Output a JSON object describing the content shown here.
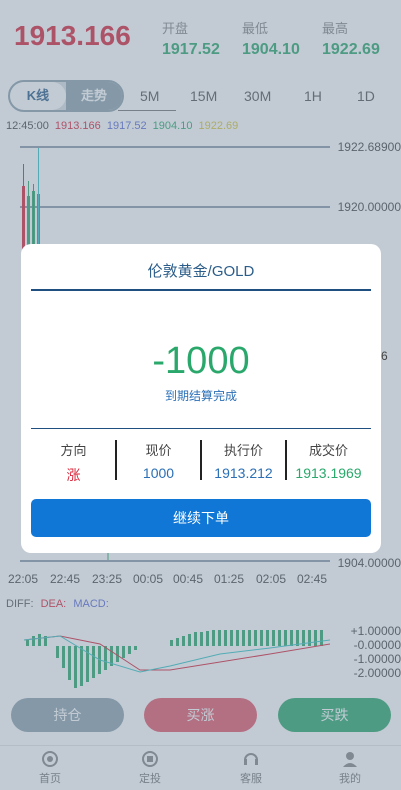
{
  "header": {
    "current_price": "1913.166",
    "stats": [
      {
        "label": "开盘",
        "value": "1917.52"
      },
      {
        "label": "最低",
        "value": "1904.10"
      },
      {
        "label": "最高",
        "value": "1922.69"
      }
    ]
  },
  "tabs": {
    "toggle": [
      "K线",
      "走势"
    ],
    "timeframes": [
      "5M",
      "15M",
      "30M",
      "1H",
      "1D"
    ]
  },
  "ticker": {
    "time": "12:45:00",
    "values": [
      "1913.166",
      "1917.52",
      "1904.10",
      "1922.69"
    ],
    "colors": [
      "#d9263b",
      "#5a6bd6",
      "#2aa86b",
      "#d8c73a"
    ]
  },
  "chart": {
    "y_labels_top": [
      "1922.68900",
      "1920.00000"
    ],
    "y_labels_bottom": [
      "1904.00000"
    ],
    "y_label_partial_6": "6",
    "x_labels": [
      "22:05",
      "22:45",
      "23:25",
      "00:05",
      "00:45",
      "01:25",
      "02:05",
      "02:45"
    ]
  },
  "indicator": {
    "legend": [
      "DIFF:",
      "DEA:",
      "MACD:"
    ],
    "legend_colors": [
      "#555",
      "#d9263b",
      "#5a6bd6"
    ],
    "y_labels": [
      "+1.00000",
      "-0.00000",
      "-1.00000",
      "-2.00000"
    ]
  },
  "actions": {
    "hold": "持仓",
    "buy_up": "买涨",
    "buy_down": "买跌"
  },
  "nav": [
    "首页",
    "定投",
    "客服",
    "我的"
  ],
  "modal": {
    "title": "伦敦黄金/GOLD",
    "amount": "-1000",
    "status": "到期结算完成",
    "columns": [
      {
        "header": "方向",
        "value": "涨",
        "color": "#d9263b"
      },
      {
        "header": "现价",
        "value": "1000",
        "color": "#2b6fb6"
      },
      {
        "header": "执行价",
        "value": "1913.212",
        "color": "#2b6fb6"
      },
      {
        "header": "成交价",
        "value": "1913.1969",
        "color": "#2aa86b"
      }
    ],
    "button": "继续下单"
  }
}
